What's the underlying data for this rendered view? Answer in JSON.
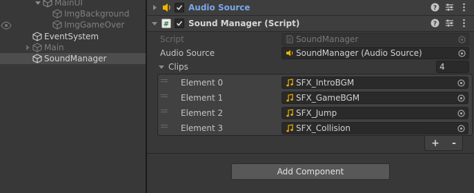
{
  "hierarchy": {
    "items": [
      {
        "label": "MainUI",
        "style": "dim"
      },
      {
        "label": "ImgBackground",
        "style": "dim"
      },
      {
        "label": "ImgGameOver",
        "style": "dim"
      },
      {
        "label": "EventSystem",
        "style": "bright"
      },
      {
        "label": "Main",
        "style": "dim"
      },
      {
        "label": "SoundManager",
        "style": "bright",
        "selected": true
      }
    ]
  },
  "inspector": {
    "audio_source": {
      "title": "Audio Source",
      "enabled": true,
      "icon": "audio-source-icon"
    },
    "sound_manager": {
      "title": "Sound Manager (Script)",
      "enabled": true,
      "icon": "script-icon",
      "script_label": "Script",
      "script_value": "SoundManager",
      "audio_source_label": "Audio Source",
      "audio_source_value": "SoundManager (Audio Source)",
      "clips_label": "Clips",
      "clips_count": "4",
      "clips": [
        {
          "label": "Element 0",
          "value": "SFX_IntroBGM"
        },
        {
          "label": "Element 1",
          "value": "SFX_GameBGM"
        },
        {
          "label": "Element 2",
          "value": "SFX_Jump"
        },
        {
          "label": "Element 3",
          "value": "SFX_Collision"
        }
      ],
      "add_symbol": "+",
      "remove_symbol": "-"
    },
    "add_component_label": "Add Component"
  },
  "colors": {
    "audio_title": "#7ba7e8",
    "audio_icon": "#f0b400",
    "clip_icon": "#e8b400",
    "background": "#383838"
  }
}
